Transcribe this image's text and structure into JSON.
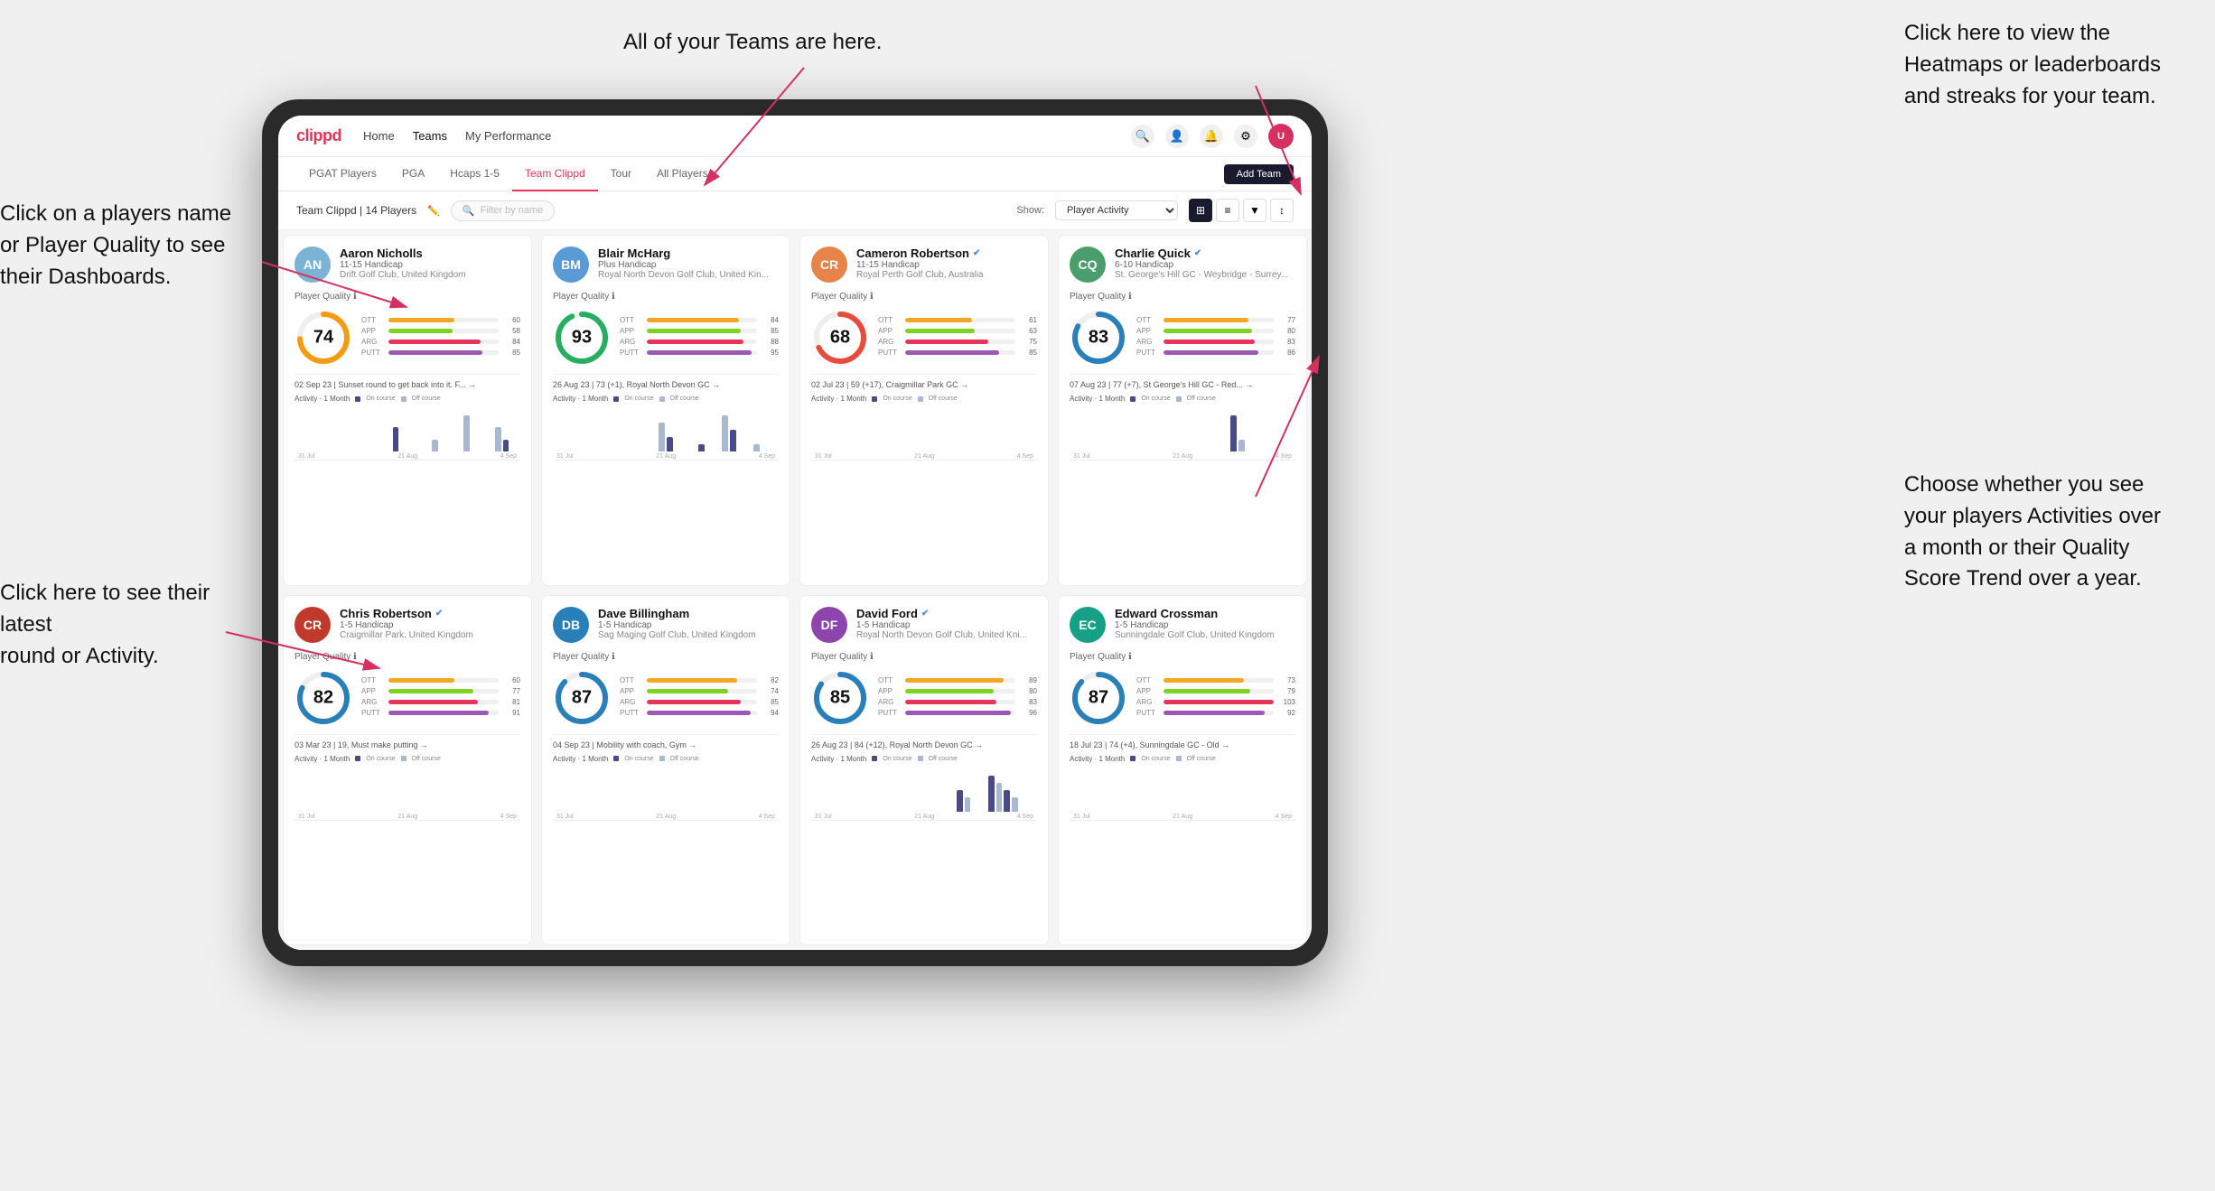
{
  "annotations": {
    "top_center": "All of your Teams are here.",
    "top_right": "Click here to view the\nHeatmaps or leaderboards\nand streaks for your team.",
    "bottom_right": "Choose whether you see\nyour players Activities over\na month or their Quality\nScore Trend over a year.",
    "left_top": "Click on a players name\nor Player Quality to see\ntheir Dashboards.",
    "left_bottom": "Click here to see their latest\nround or Activity."
  },
  "nav": {
    "logo": "clippd",
    "items": [
      "Home",
      "Teams",
      "My Performance"
    ],
    "active": "Teams"
  },
  "sub_nav": {
    "items": [
      "PGAT Players",
      "PGA",
      "Hcaps 1-5",
      "Team Clippd",
      "Tour",
      "All Players"
    ],
    "active": "Team Clippd",
    "add_button": "Add Team"
  },
  "team_controls": {
    "label": "Team Clippd | 14 Players",
    "search_placeholder": "Filter by name",
    "show_label": "Show:",
    "show_option": "Player Activity"
  },
  "players": [
    {
      "name": "Aaron Nicholls",
      "handicap": "11-15 Handicap",
      "club": "Drift Golf Club, United Kingdom",
      "quality": 74,
      "verified": false,
      "color": "#7ab3d4",
      "ott": 60,
      "app": 58,
      "arg": 84,
      "putt": 85,
      "ott_color": "#f5a623",
      "app_color": "#7ed321",
      "arg_color": "#e8345a",
      "putt_color": "#9b59b6",
      "latest_round": "02 Sep 23 | Sunset round to get back into it. F... →",
      "chart_data": [
        0,
        0,
        0,
        0,
        0,
        0,
        0,
        0,
        0,
        0,
        0,
        0,
        2,
        0,
        0,
        0,
        0,
        1,
        0,
        0,
        0,
        3,
        0,
        0,
        0,
        2,
        1,
        0
      ],
      "chart_labels": [
        "31 Jul",
        "21 Aug",
        "4 Sep"
      ]
    },
    {
      "name": "Blair McHarg",
      "handicap": "Plus Handicap",
      "club": "Royal North Devon Golf Club, United Kin...",
      "quality": 93,
      "verified": false,
      "color": "#5b9bd5",
      "ott": 84,
      "app": 85,
      "arg": 88,
      "putt": 95,
      "ott_color": "#f5a623",
      "app_color": "#7ed321",
      "arg_color": "#e8345a",
      "putt_color": "#9b59b6",
      "latest_round": "26 Aug 23 | 73 (+1), Royal North Devon GC →",
      "chart_data": [
        0,
        0,
        0,
        0,
        0,
        0,
        0,
        0,
        0,
        0,
        0,
        0,
        0,
        4,
        2,
        0,
        0,
        0,
        1,
        0,
        0,
        5,
        3,
        0,
        0,
        1,
        0,
        0
      ],
      "chart_labels": [
        "31 Jul",
        "21 Aug",
        "4 Sep"
      ]
    },
    {
      "name": "Cameron Robertson",
      "handicap": "11-15 Handicap",
      "club": "Royal Perth Golf Club, Australia",
      "quality": 68,
      "verified": true,
      "color": "#e8834a",
      "ott": 61,
      "app": 63,
      "arg": 75,
      "putt": 85,
      "ott_color": "#f5a623",
      "app_color": "#7ed321",
      "arg_color": "#e8345a",
      "putt_color": "#9b59b6",
      "latest_round": "02 Jul 23 | 59 (+17), Craigmillar Park GC →",
      "chart_data": [
        0,
        0,
        0,
        0,
        0,
        0,
        0,
        0,
        0,
        0,
        0,
        0,
        0,
        0,
        0,
        0,
        0,
        0,
        0,
        0,
        0,
        0,
        0,
        0,
        0,
        0,
        0,
        0
      ],
      "chart_labels": [
        "31 Jul",
        "21 Aug",
        "4 Sep"
      ]
    },
    {
      "name": "Charlie Quick",
      "handicap": "6-10 Handicap",
      "club": "St. George's Hill GC - Weybridge - Surrey...",
      "quality": 83,
      "verified": true,
      "color": "#4a9e6b",
      "ott": 77,
      "app": 80,
      "arg": 83,
      "putt": 86,
      "ott_color": "#f5a623",
      "app_color": "#7ed321",
      "arg_color": "#e8345a",
      "putt_color": "#9b59b6",
      "latest_round": "07 Aug 23 | 77 (+7), St George's Hill GC - Red... →",
      "chart_data": [
        0,
        0,
        0,
        0,
        0,
        0,
        0,
        0,
        0,
        0,
        0,
        0,
        0,
        0,
        0,
        0,
        0,
        0,
        0,
        0,
        3,
        1,
        0,
        0,
        0,
        0,
        0,
        0
      ],
      "chart_labels": [
        "31 Jul",
        "21 Aug",
        "4 Sep"
      ]
    },
    {
      "name": "Chris Robertson",
      "handicap": "1-5 Handicap",
      "club": "Craigmillar Park, United Kingdom",
      "quality": 82,
      "verified": true,
      "color": "#c0392b",
      "ott": 60,
      "app": 77,
      "arg": 81,
      "putt": 91,
      "ott_color": "#f5a623",
      "app_color": "#7ed321",
      "arg_color": "#e8345a",
      "putt_color": "#9b59b6",
      "latest_round": "03 Mar 23 | 19, Must make putting →",
      "chart_data": [
        0,
        0,
        0,
        0,
        0,
        0,
        0,
        0,
        0,
        0,
        0,
        0,
        0,
        0,
        0,
        0,
        0,
        0,
        0,
        0,
        0,
        0,
        0,
        0,
        0,
        0,
        0,
        0
      ],
      "chart_labels": [
        "31 Jul",
        "21 Aug",
        "4 Sep"
      ]
    },
    {
      "name": "Dave Billingham",
      "handicap": "1-5 Handicap",
      "club": "Sag Maging Golf Club, United Kingdom",
      "quality": 87,
      "verified": false,
      "color": "#2980b9",
      "ott": 82,
      "app": 74,
      "arg": 85,
      "putt": 94,
      "ott_color": "#f5a623",
      "app_color": "#7ed321",
      "arg_color": "#e8345a",
      "putt_color": "#9b59b6",
      "latest_round": "04 Sep 23 | Mobility with coach, Gym →",
      "chart_data": [
        0,
        0,
        0,
        0,
        0,
        0,
        0,
        0,
        0,
        0,
        0,
        0,
        0,
        0,
        0,
        0,
        0,
        0,
        0,
        0,
        0,
        0,
        0,
        0,
        0,
        0,
        0,
        0
      ],
      "chart_labels": [
        "31 Jul",
        "21 Aug",
        "4 Sep"
      ]
    },
    {
      "name": "David Ford",
      "handicap": "1-5 Handicap",
      "club": "Royal North Devon Golf Club, United Kni...",
      "quality": 85,
      "verified": true,
      "color": "#8e44ad",
      "ott": 89,
      "app": 80,
      "arg": 83,
      "putt": 96,
      "ott_color": "#f5a623",
      "app_color": "#7ed321",
      "arg_color": "#e8345a",
      "putt_color": "#9b59b6",
      "latest_round": "26 Aug 23 | 84 (+12), Royal North Devon GC →",
      "chart_data": [
        0,
        0,
        0,
        0,
        0,
        0,
        0,
        0,
        0,
        0,
        0,
        0,
        0,
        0,
        0,
        0,
        0,
        0,
        3,
        2,
        0,
        0,
        5,
        4,
        3,
        2,
        0,
        0
      ],
      "chart_labels": [
        "31 Jul",
        "21 Aug",
        "4 Sep"
      ]
    },
    {
      "name": "Edward Crossman",
      "handicap": "1-5 Handicap",
      "club": "Sunningdale Golf Club, United Kingdom",
      "quality": 87,
      "verified": false,
      "color": "#16a085",
      "ott": 73,
      "app": 79,
      "arg": 103,
      "putt": 92,
      "ott_color": "#f5a623",
      "app_color": "#7ed321",
      "arg_color": "#e8345a",
      "putt_color": "#9b59b6",
      "latest_round": "18 Jul 23 | 74 (+4), Sunningdale GC - Old →",
      "chart_data": [
        0,
        0,
        0,
        0,
        0,
        0,
        0,
        0,
        0,
        0,
        0,
        0,
        0,
        0,
        0,
        0,
        0,
        0,
        0,
        0,
        0,
        0,
        0,
        0,
        0,
        0,
        0,
        0
      ],
      "chart_labels": [
        "31 Jul",
        "21 Aug",
        "4 Sep"
      ]
    }
  ],
  "activity": {
    "title": "Activity",
    "period": "1 Month",
    "on_course_label": "On course",
    "off_course_label": "Off course",
    "on_course_color": "#4a4a8a",
    "off_course_color": "#a8b8d0"
  }
}
